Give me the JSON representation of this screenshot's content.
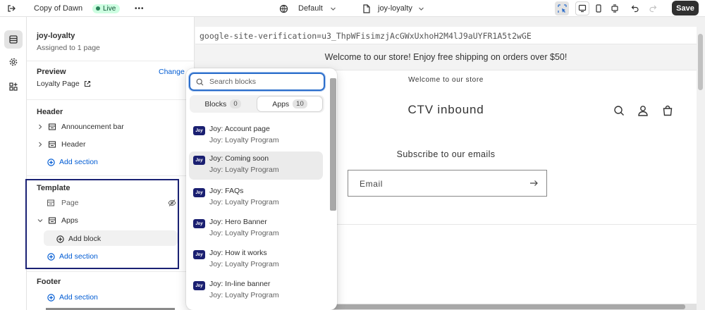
{
  "topbar": {
    "theme_name": "Copy of Dawn",
    "status_badge": "Live",
    "more_label": "•••",
    "template_default": "Default",
    "page_selector": "joy-loyalty",
    "save_label": "Save"
  },
  "sidebar": {
    "page_title": "joy-loyalty",
    "assigned": "Assigned to 1 page",
    "preview_label": "Preview",
    "change_label": "Change",
    "preview_page": "Loyalty Page",
    "header_section": "Header",
    "header_items": [
      "Announcement bar",
      "Header"
    ],
    "add_section": "Add section",
    "template_section": "Template",
    "template_items": [
      "Page",
      "Apps"
    ],
    "add_block": "Add block",
    "footer_section": "Footer"
  },
  "preview": {
    "verification": "google-site-verification=u3_ThpWFisimzjAcGWxUxhoH2M4lJ9aUYFR1A5t2wGE",
    "announcement": "Welcome to our store! Enjoy free shipping on orders over $50!",
    "welcome": "Welcome to our store",
    "brand": "CTV inbound",
    "subscribe_title": "Subscribe to our emails",
    "email_label": "Email"
  },
  "picker": {
    "search_placeholder": "Search blocks",
    "tabs": [
      {
        "label": "Blocks",
        "count": "0"
      },
      {
        "label": "Apps",
        "count": "10"
      }
    ],
    "logo_text": "Joy",
    "blocks": [
      {
        "title": "Joy: Account page",
        "sub": "Joy: Loyalty Program"
      },
      {
        "title": "Joy: Coming soon",
        "sub": "Joy: Loyalty Program"
      },
      {
        "title": "Joy: FAQs",
        "sub": "Joy: Loyalty Program"
      },
      {
        "title": "Joy: Hero Banner",
        "sub": "Joy: Loyalty Program"
      },
      {
        "title": "Joy: How it works",
        "sub": "Joy: Loyalty Program"
      },
      {
        "title": "Joy: In-line banner",
        "sub": "Joy: Loyalty Program"
      }
    ]
  },
  "colors": {
    "accent_blue": "#005bd3",
    "focus_blue": "#2c6ecb",
    "highlight_navy": "#1a2174",
    "live_green": "#29845a",
    "joy_logo": "#1a1f71",
    "save_button": "#303030"
  }
}
